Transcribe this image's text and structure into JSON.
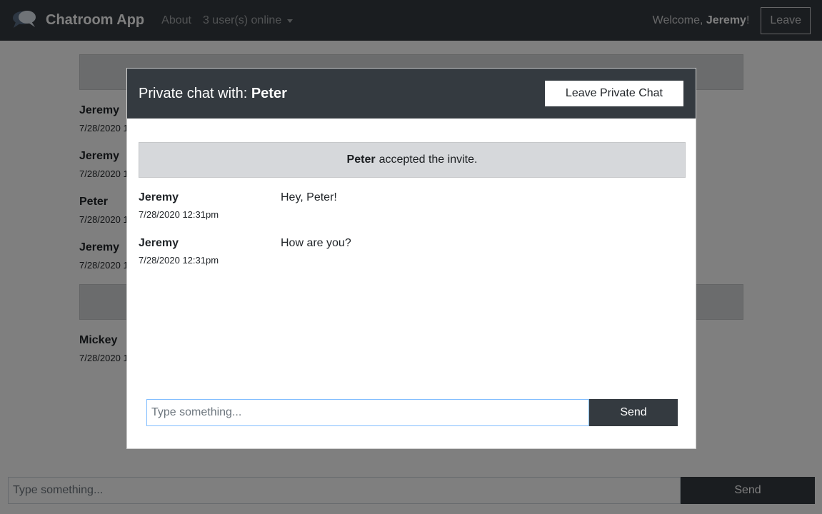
{
  "navbar": {
    "brand": "Chatroom App",
    "about": "About",
    "users_online": "3 user(s) online",
    "welcome_prefix": "Welcome, ",
    "welcome_user": "Jeremy",
    "welcome_suffix": "!",
    "leave": "Leave"
  },
  "background_chat": {
    "messages": [
      {
        "user": "Jeremy",
        "time": "7/28/2020 1"
      },
      {
        "user": "Jeremy",
        "time": "7/28/2020 1"
      },
      {
        "user": "Peter",
        "time": "7/28/2020 1"
      },
      {
        "user": "Jeremy",
        "time": "7/28/2020 1"
      },
      {
        "user": "Mickey",
        "time": "7/28/2020 1"
      }
    ],
    "input_placeholder": "Type something...",
    "send": "Send"
  },
  "modal": {
    "title_prefix": "Private chat with: ",
    "title_user": "Peter",
    "leave_button": "Leave Private Chat",
    "notice_user": "Peter",
    "notice_text": "accepted the invite.",
    "messages": [
      {
        "user": "Jeremy",
        "time": "7/28/2020 12:31pm",
        "text": "Hey, Peter!"
      },
      {
        "user": "Jeremy",
        "time": "7/28/2020 12:31pm",
        "text": "How are you?"
      }
    ],
    "input_placeholder": "Type something...",
    "send": "Send"
  },
  "colors": {
    "navbar": "#343a40",
    "banner": "#d6d8db",
    "input_focus_border": "#80bdff"
  }
}
